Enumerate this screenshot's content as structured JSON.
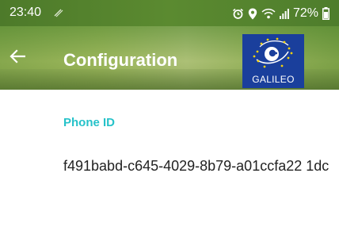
{
  "status_bar": {
    "time": "23:40",
    "battery_percent": "72%",
    "icons": [
      "nfc-icon",
      "alarm-icon",
      "location-icon",
      "wifi-icon",
      "signal-icon",
      "battery-icon"
    ]
  },
  "app_bar": {
    "title": "Configuration",
    "back_icon": "arrow-left-icon",
    "logo_text": "GALILEO"
  },
  "content": {
    "phone_id_label": "Phone ID",
    "phone_id_value": "f491babd-c645-4029-8b79-a01ccfa22 1dc"
  },
  "colors": {
    "accent": "#26c2c9",
    "logo_background": "#1a3f9c",
    "app_bar_green": "#7ea44c"
  }
}
